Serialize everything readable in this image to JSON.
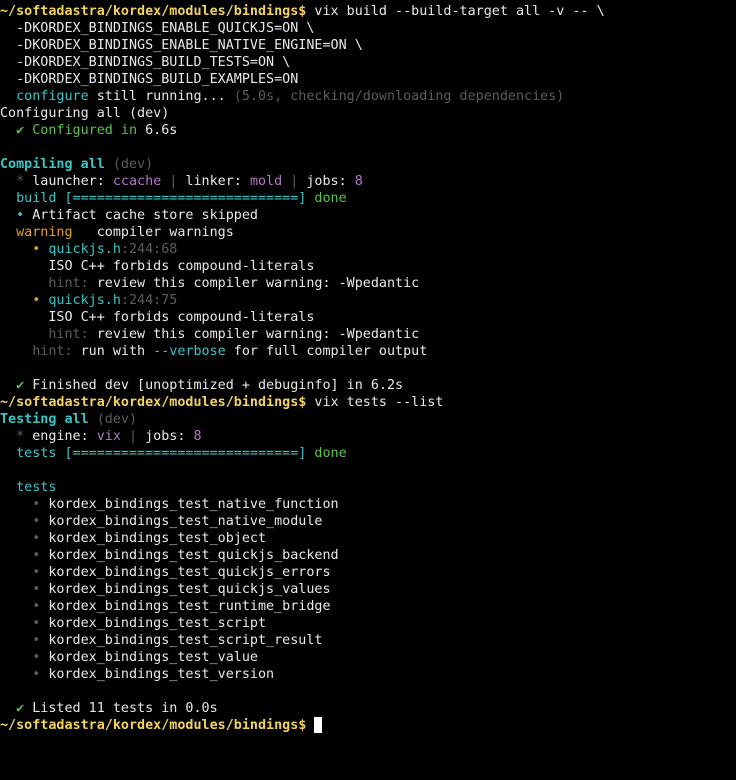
{
  "colors": {
    "background": "#000000",
    "prompt": "#f2d35b",
    "cyan": "#38c6c6",
    "green": "#5bc14f",
    "dim": "#5c5c5c",
    "purple": "#b476c8",
    "warning": "#e0a21d",
    "text": "#e8e8e8"
  },
  "prompt": "~/softadastra/kordex/modules/bindings$",
  "build_section": {
    "command": " vix build --build-target all -v -- \\",
    "flags": [
      "  -DKORDEX_BINDINGS_ENABLE_QUICKJS=ON \\",
      "  -DKORDEX_BINDINGS_ENABLE_NATIVE_ENGINE=ON \\",
      "  -DKORDEX_BINDINGS_BUILD_TESTS=ON \\",
      "  -DKORDEX_BINDINGS_BUILD_EXAMPLES=ON"
    ],
    "configure_word": "  configure",
    "configure_still": " still running... ",
    "configure_note": "(5.0s, checking/downloading dependencies)",
    "configuring_line": "Configuring all (dev)",
    "configured_check": "  ✔ ",
    "configured_label": "Configured in ",
    "configured_time": "6.6s",
    "compiling_label": "Compiling all",
    "compiling_mode": " (dev)",
    "launcher_star": "  * ",
    "launcher_label": "launcher: ",
    "launcher_value": "ccache",
    "sep1": " | ",
    "linker_label": "linker: ",
    "linker_value": "mold",
    "sep2": " | ",
    "jobs_label": "jobs: ",
    "jobs_value": "8",
    "build_bar": "  build [============================] ",
    "build_done": "done",
    "artifact_bullet": "  • ",
    "artifact_text": "Artifact cache store skipped",
    "warning_word": "  warning",
    "warning_text": "   compiler warnings",
    "warn1_bullet": "    • ",
    "warn1_file": "quickjs.h",
    "warn1_loc": ":244:68",
    "warn1_msg": "      ISO C++ forbids compound-literals",
    "warn1_hint": "      hint:",
    "warn1_hint_text": " review this compiler warning: -Wpedantic",
    "warn2_bullet": "    • ",
    "warn2_file": "quickjs.h",
    "warn2_loc": ":244:75",
    "warn2_msg": "      ISO C++ forbids compound-literals",
    "warn2_hint": "      hint:",
    "warn2_hint_text": " review this compiler warning: -Wpedantic",
    "verbose_hint": "    hint:",
    "verbose_pre": " run with ",
    "verbose_flag": "--verbose",
    "verbose_post": " for full compiler output",
    "finished_check": "  ✔ ",
    "finished_text": "Finished dev [unoptimized + debuginfo] in 6.2s"
  },
  "test_section": {
    "command": " vix tests --list",
    "testing_label": "Testing all",
    "testing_mode": " (dev)",
    "engine_star": "  * ",
    "engine_label": "engine: ",
    "engine_value": "vix",
    "sep": " | ",
    "jobs_label": "jobs: ",
    "jobs_value": "8",
    "tests_bar": "  tests [============================] ",
    "tests_done": "done",
    "tests_heading": "  tests",
    "bullet": "    • ",
    "tests": [
      "kordex_bindings_test_native_function",
      "kordex_bindings_test_native_module",
      "kordex_bindings_test_object",
      "kordex_bindings_test_quickjs_backend",
      "kordex_bindings_test_quickjs_errors",
      "kordex_bindings_test_quickjs_values",
      "kordex_bindings_test_runtime_bridge",
      "kordex_bindings_test_script",
      "kordex_bindings_test_script_result",
      "kordex_bindings_test_value",
      "kordex_bindings_test_version"
    ],
    "listed_check": "  ✔ ",
    "listed_text": "Listed 11 tests in 0.0s"
  }
}
